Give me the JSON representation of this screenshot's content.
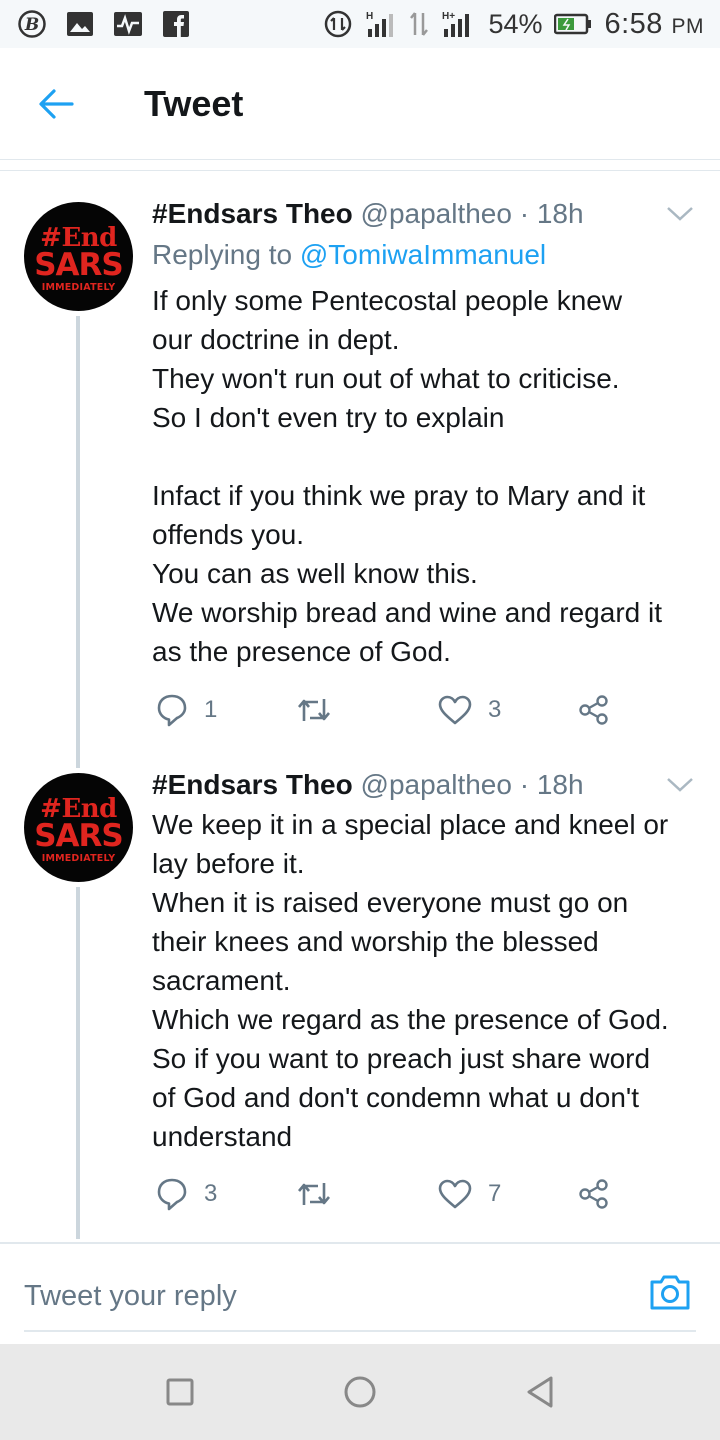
{
  "status_bar": {
    "battery": "54%",
    "time": "6:58",
    "ampm": "PM",
    "network1": "H",
    "network2": "H+"
  },
  "header": {
    "title": "Tweet"
  },
  "avatar_text": {
    "line1": "#End",
    "line2": "SARS",
    "line3": "IMMEDIATELY"
  },
  "tweets": [
    {
      "name": "#Endsars Theo",
      "handle": "@papaltheo",
      "dot": "·",
      "time": "18h",
      "replying_prefix": "Replying to ",
      "replying_to": "@TomiwaImmanuel",
      "body": "If only some Pentecostal people knew\nour doctrine in dept.\nThey won't run out of what to criticise.\nSo I don't even try to explain\n\nInfact if you think we pray to Mary and it\noffends you.\nYou can as well know this.\nWe worship bread and wine and regard it\nas the presence of God.",
      "replies": "1",
      "retweets": "",
      "likes": "3"
    },
    {
      "name": "#Endsars Theo",
      "handle": "@papaltheo",
      "dot": "·",
      "time": "18h",
      "body": "We keep it in a special place and kneel or\nlay before it.\nWhen it is raised everyone must go on\ntheir knees and worship the blessed\nsacrament.\nWhich we regard as the presence of God.\nSo if you want to preach just share word\nof God and don't condemn what u don't\nunderstand",
      "replies": "3",
      "retweets": "",
      "likes": "7"
    }
  ],
  "reply_box": {
    "placeholder": "Tweet your reply"
  },
  "colors": {
    "accent": "#1da1f2",
    "secondary_text": "#657786",
    "avatar_red": "#e0251f",
    "navbar_bg": "#e9e9e9"
  }
}
